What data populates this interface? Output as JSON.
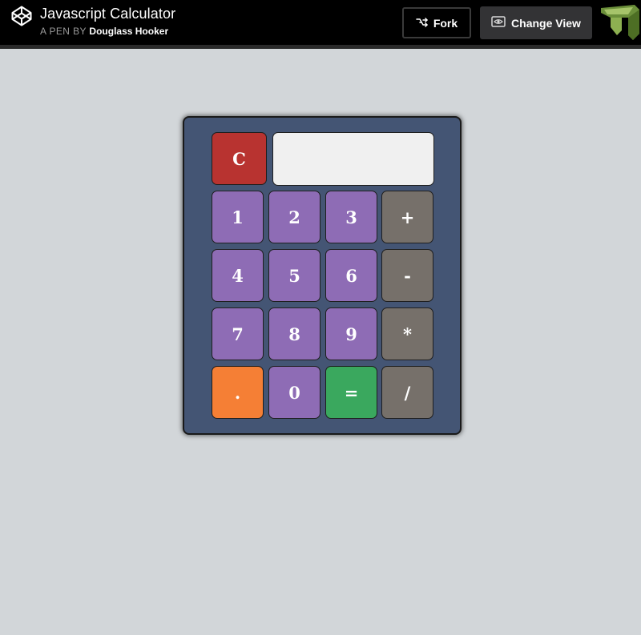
{
  "header": {
    "title": "Javascript Calculator",
    "byline_prefix": "A PEN BY",
    "author": "Douglass Hooker",
    "fork_label": "Fork",
    "change_view_label": "Change View",
    "logo_icon": "codepen-cube-icon",
    "fork_icon": "fork-branch-icon",
    "change_view_icon": "eye-icon"
  },
  "calculator": {
    "display_value": "",
    "keys": {
      "clear": "C",
      "one": "1",
      "two": "2",
      "three": "3",
      "plus": "+",
      "four": "4",
      "five": "5",
      "six": "6",
      "minus": "-",
      "seven": "7",
      "eight": "8",
      "nine": "9",
      "multiply": "*",
      "dot": ".",
      "zero": "0",
      "equals": "=",
      "divide": "/"
    }
  },
  "colors": {
    "page_bg": "#d2d6d9",
    "calc_body": "#445574",
    "number_key": "#8e6cb5",
    "operator_key": "#76706a",
    "clear_key": "#b83330",
    "dot_key": "#f57f35",
    "equals_key": "#3aa85e",
    "display_bg": "#f0f0f0"
  }
}
